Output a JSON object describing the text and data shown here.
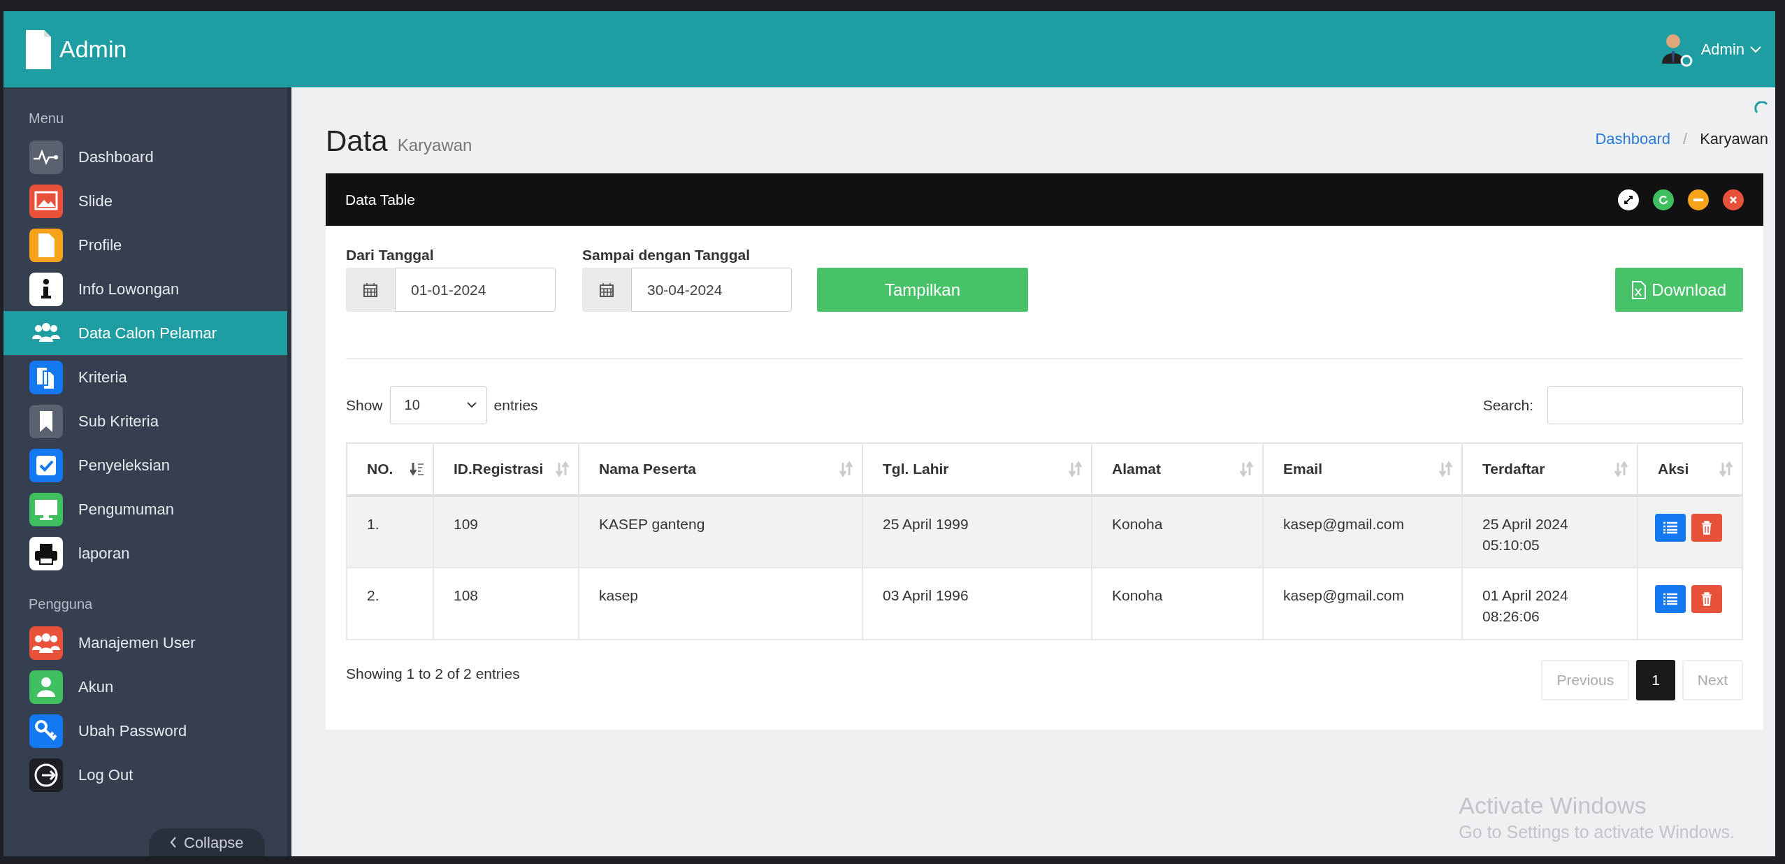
{
  "header": {
    "brand": "Admin",
    "user": "Admin"
  },
  "sidebar": {
    "sections": [
      {
        "title": "Menu",
        "items": [
          {
            "label": "Dashboard",
            "kind": "chart",
            "selected": false
          },
          {
            "label": "Slide",
            "kind": "image",
            "selected": false
          },
          {
            "label": "Profile",
            "kind": "file",
            "selected": false
          },
          {
            "label": "Info Lowongan",
            "kind": "info",
            "selected": false
          },
          {
            "label": "Data Calon Pelamar",
            "kind": "users",
            "selected": true
          },
          {
            "label": "Kriteria",
            "kind": "copy",
            "selected": false
          },
          {
            "label": "Sub Kriteria",
            "kind": "bookmark",
            "selected": false
          },
          {
            "label": "Penyeleksian",
            "kind": "check",
            "selected": false
          },
          {
            "label": "Pengumuman",
            "kind": "monitor",
            "selected": false
          },
          {
            "label": "laporan",
            "kind": "print",
            "selected": false
          }
        ]
      },
      {
        "title": "Pengguna",
        "items": [
          {
            "label": "Manajemen User",
            "kind": "group",
            "selected": false
          },
          {
            "label": "Akun",
            "kind": "user",
            "selected": false
          },
          {
            "label": "Ubah Password",
            "kind": "key",
            "selected": false
          },
          {
            "label": "Log Out",
            "kind": "logout",
            "selected": false
          }
        ]
      }
    ],
    "collapse": "Collapse"
  },
  "page": {
    "title": "Data",
    "subtitle": "Karyawan",
    "separator": "/",
    "breadcrumb": [
      {
        "label": "Dashboard",
        "kind": "link"
      },
      {
        "label": "Karyawan",
        "kind": "current"
      }
    ]
  },
  "panel": {
    "title": "Data Table",
    "filters": [
      {
        "label": "Dari Tanggal",
        "value": "01-01-2024"
      },
      {
        "label": "Sampai dengan Tanggal",
        "value": "30-04-2024"
      }
    ],
    "show_button": "Tampilkan",
    "download_button": "Download",
    "length": {
      "prefix": "Show",
      "value": "10",
      "suffix": "entries"
    },
    "search_label": "Search:",
    "table": {
      "columns": [
        {
          "label": "NO.",
          "sorted": true
        },
        {
          "label": "ID.Registrasi",
          "sorted": false
        },
        {
          "label": "Nama Peserta",
          "sorted": false
        },
        {
          "label": "Tgl. Lahir",
          "sorted": false
        },
        {
          "label": "Alamat",
          "sorted": false
        },
        {
          "label": "Email",
          "sorted": false
        },
        {
          "label": "Terdaftar",
          "sorted": false
        },
        {
          "label": "Aksi",
          "sorted": false
        }
      ],
      "rows": [
        {
          "cells": [
            "1.",
            "109",
            "KASEP ganteng",
            "25 April 1999",
            "Konoha",
            "kasep@gmail.com",
            "25 April 2024 05:10:05"
          ]
        },
        {
          "cells": [
            "2.",
            "108",
            "kasep",
            "03 April 1996",
            "Konoha",
            "kasep@gmail.com",
            "01 April 2024 08:26:06"
          ]
        }
      ]
    },
    "info": "Showing 1 to 2 of 2 entries",
    "pagination": [
      {
        "label": "Previous",
        "selected": false,
        "disabled": true
      },
      {
        "label": "1",
        "selected": true,
        "disabled": false
      },
      {
        "label": "Next",
        "selected": false,
        "disabled": true
      }
    ]
  },
  "os_overlay": {
    "title": "Activate Windows",
    "text": "Go to Settings to activate Windows."
  }
}
